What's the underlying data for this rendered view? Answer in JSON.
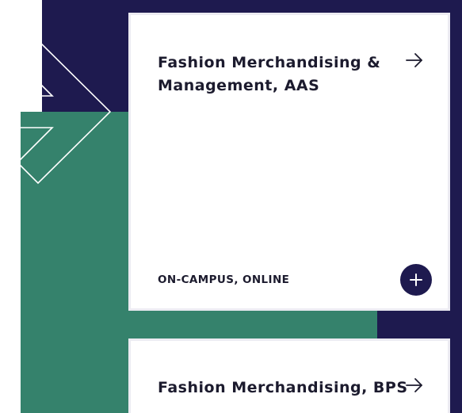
{
  "colors": {
    "navy": "#1e1a4f",
    "green": "#35826c",
    "text": "#1c1b2e",
    "card_border": "#ecebf2"
  },
  "programs": [
    {
      "title": "Fashion Merchandising & Management, AAS",
      "delivery": "ON-CAMPUS, ONLINE",
      "arrow_icon": "arrow-right-icon",
      "expand_icon": "plus-icon"
    },
    {
      "title": "Fashion Merchandising, BPS",
      "arrow_icon": "arrow-right-icon"
    }
  ]
}
